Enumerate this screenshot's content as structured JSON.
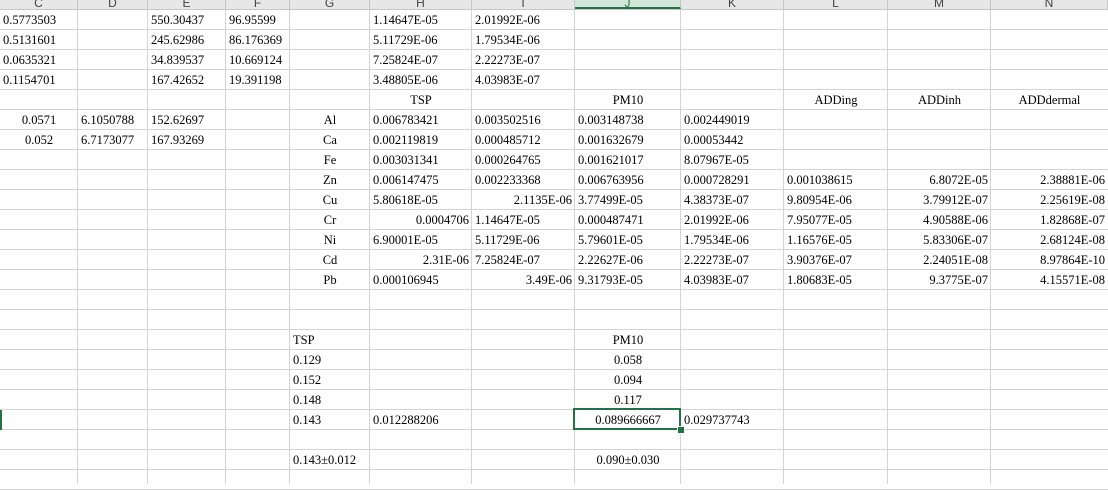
{
  "columns": [
    "C",
    "D",
    "E",
    "F",
    "G",
    "H",
    "I",
    "J",
    "K",
    "L",
    "M",
    "N"
  ],
  "selected_column": "J",
  "rows": [
    [
      {
        "c": 0,
        "v": "0.5773503",
        "a": "l"
      },
      {
        "c": 2,
        "v": "550.30437",
        "a": "l"
      },
      {
        "c": 3,
        "v": "96.95599",
        "a": "l"
      },
      {
        "c": 5,
        "v": "1.14647E-05",
        "a": "l"
      },
      {
        "c": 6,
        "v": "2.01992E-06",
        "a": "l"
      }
    ],
    [
      {
        "c": 0,
        "v": "0.5131601",
        "a": "l"
      },
      {
        "c": 2,
        "v": "245.62986",
        "a": "l"
      },
      {
        "c": 3,
        "v": "86.176369",
        "a": "l"
      },
      {
        "c": 5,
        "v": "5.11729E-06",
        "a": "l"
      },
      {
        "c": 6,
        "v": "1.79534E-06",
        "a": "l"
      }
    ],
    [
      {
        "c": 0,
        "v": "0.0635321",
        "a": "l"
      },
      {
        "c": 2,
        "v": "34.839537",
        "a": "l"
      },
      {
        "c": 3,
        "v": "10.669124",
        "a": "l"
      },
      {
        "c": 5,
        "v": "7.25824E-07",
        "a": "l"
      },
      {
        "c": 6,
        "v": "2.22273E-07",
        "a": "l"
      }
    ],
    [
      {
        "c": 0,
        "v": "0.1154701",
        "a": "l"
      },
      {
        "c": 2,
        "v": "167.42652",
        "a": "l"
      },
      {
        "c": 3,
        "v": "19.391198",
        "a": "l"
      },
      {
        "c": 5,
        "v": "3.48805E-06",
        "a": "l"
      },
      {
        "c": 6,
        "v": "4.03983E-07",
        "a": "l"
      }
    ],
    [
      {
        "c": 5,
        "v": "TSP",
        "a": "c"
      },
      {
        "c": 7,
        "v": "PM10",
        "a": "c"
      },
      {
        "c": 9,
        "v": "ADDing",
        "a": "c"
      },
      {
        "c": 10,
        "v": "ADDinh",
        "a": "c"
      },
      {
        "c": 11,
        "v": "ADDdermal",
        "a": "c"
      }
    ],
    [
      {
        "c": 0,
        "v": "0.0571",
        "a": "c"
      },
      {
        "c": 1,
        "v": "6.1050788",
        "a": "l"
      },
      {
        "c": 2,
        "v": "152.62697",
        "a": "l"
      },
      {
        "c": 4,
        "v": "Al",
        "a": "c"
      },
      {
        "c": 5,
        "v": "0.006783421",
        "a": "l"
      },
      {
        "c": 6,
        "v": "0.003502516",
        "a": "l"
      },
      {
        "c": 7,
        "v": "0.003148738",
        "a": "l"
      },
      {
        "c": 8,
        "v": "0.002449019",
        "a": "l"
      }
    ],
    [
      {
        "c": 0,
        "v": "0.052",
        "a": "c"
      },
      {
        "c": 1,
        "v": "6.7173077",
        "a": "l"
      },
      {
        "c": 2,
        "v": "167.93269",
        "a": "l"
      },
      {
        "c": 4,
        "v": "Ca",
        "a": "c"
      },
      {
        "c": 5,
        "v": "0.002119819",
        "a": "l"
      },
      {
        "c": 6,
        "v": "0.000485712",
        "a": "l"
      },
      {
        "c": 7,
        "v": "0.001632679",
        "a": "l"
      },
      {
        "c": 8,
        "v": "0.00053442",
        "a": "l"
      }
    ],
    [
      {
        "c": 4,
        "v": "Fe",
        "a": "c"
      },
      {
        "c": 5,
        "v": "0.003031341",
        "a": "l"
      },
      {
        "c": 6,
        "v": "0.000264765",
        "a": "l"
      },
      {
        "c": 7,
        "v": "0.001621017",
        "a": "l"
      },
      {
        "c": 8,
        "v": "8.07967E-05",
        "a": "l"
      }
    ],
    [
      {
        "c": 4,
        "v": "Zn",
        "a": "c"
      },
      {
        "c": 5,
        "v": "0.006147475",
        "a": "l"
      },
      {
        "c": 6,
        "v": "0.002233368",
        "a": "l"
      },
      {
        "c": 7,
        "v": "0.006763956",
        "a": "l"
      },
      {
        "c": 8,
        "v": "0.000728291",
        "a": "l"
      },
      {
        "c": 9,
        "v": "0.001038615",
        "a": "l"
      },
      {
        "c": 10,
        "v": "6.8072E-05",
        "a": "r"
      },
      {
        "c": 11,
        "v": "2.38881E-06",
        "a": "r"
      }
    ],
    [
      {
        "c": 4,
        "v": "Cu",
        "a": "c"
      },
      {
        "c": 5,
        "v": "5.80618E-05",
        "a": "l"
      },
      {
        "c": 6,
        "v": "2.1135E-06",
        "a": "r"
      },
      {
        "c": 7,
        "v": "3.77499E-05",
        "a": "l"
      },
      {
        "c": 8,
        "v": "4.38373E-07",
        "a": "l"
      },
      {
        "c": 9,
        "v": "9.80954E-06",
        "a": "l"
      },
      {
        "c": 10,
        "v": "3.79912E-07",
        "a": "r"
      },
      {
        "c": 11,
        "v": "2.25619E-08",
        "a": "r"
      }
    ],
    [
      {
        "c": 4,
        "v": "Cr",
        "a": "c"
      },
      {
        "c": 5,
        "v": "0.0004706",
        "a": "r"
      },
      {
        "c": 6,
        "v": "1.14647E-05",
        "a": "l"
      },
      {
        "c": 7,
        "v": "0.000487471",
        "a": "l"
      },
      {
        "c": 8,
        "v": "2.01992E-06",
        "a": "l"
      },
      {
        "c": 9,
        "v": "7.95077E-05",
        "a": "l"
      },
      {
        "c": 10,
        "v": "4.90588E-06",
        "a": "r"
      },
      {
        "c": 11,
        "v": "1.82868E-07",
        "a": "r"
      }
    ],
    [
      {
        "c": 4,
        "v": "Ni",
        "a": "c"
      },
      {
        "c": 5,
        "v": "6.90001E-05",
        "a": "l"
      },
      {
        "c": 6,
        "v": "5.11729E-06",
        "a": "l"
      },
      {
        "c": 7,
        "v": "5.79601E-05",
        "a": "l"
      },
      {
        "c": 8,
        "v": "1.79534E-06",
        "a": "l"
      },
      {
        "c": 9,
        "v": "1.16576E-05",
        "a": "l"
      },
      {
        "c": 10,
        "v": "5.83306E-07",
        "a": "r"
      },
      {
        "c": 11,
        "v": "2.68124E-08",
        "a": "r"
      }
    ],
    [
      {
        "c": 4,
        "v": "Cd",
        "a": "c"
      },
      {
        "c": 5,
        "v": "2.31E-06",
        "a": "r"
      },
      {
        "c": 6,
        "v": "7.25824E-07",
        "a": "l"
      },
      {
        "c": 7,
        "v": "2.22627E-06",
        "a": "l"
      },
      {
        "c": 8,
        "v": "2.22273E-07",
        "a": "l"
      },
      {
        "c": 9,
        "v": "3.90376E-07",
        "a": "l"
      },
      {
        "c": 10,
        "v": "2.24051E-08",
        "a": "r"
      },
      {
        "c": 11,
        "v": "8.97864E-10",
        "a": "r"
      }
    ],
    [
      {
        "c": 4,
        "v": "Pb",
        "a": "c"
      },
      {
        "c": 5,
        "v": "0.000106945",
        "a": "l"
      },
      {
        "c": 6,
        "v": "3.49E-06",
        "a": "r"
      },
      {
        "c": 7,
        "v": "9.31793E-05",
        "a": "l"
      },
      {
        "c": 8,
        "v": "4.03983E-07",
        "a": "l"
      },
      {
        "c": 9,
        "v": "1.80683E-05",
        "a": "l"
      },
      {
        "c": 10,
        "v": "9.3775E-07",
        "a": "r"
      },
      {
        "c": 11,
        "v": "4.15571E-08",
        "a": "r"
      }
    ],
    [],
    [],
    [
      {
        "c": 4,
        "v": "TSP",
        "a": "l"
      },
      {
        "c": 7,
        "v": "PM10",
        "a": "c"
      }
    ],
    [
      {
        "c": 4,
        "v": "0.129",
        "a": "l"
      },
      {
        "c": 7,
        "v": "0.058",
        "a": "c"
      }
    ],
    [
      {
        "c": 4,
        "v": "0.152",
        "a": "l"
      },
      {
        "c": 7,
        "v": "0.094",
        "a": "c"
      }
    ],
    [
      {
        "c": 4,
        "v": "0.148",
        "a": "l"
      },
      {
        "c": 7,
        "v": "0.117",
        "a": "c"
      }
    ],
    [
      {
        "c": 4,
        "v": "0.143",
        "a": "l"
      },
      {
        "c": 5,
        "v": "0.012288206",
        "a": "l"
      },
      {
        "c": 7,
        "v": "0.089666667",
        "a": "c"
      },
      {
        "c": 8,
        "v": "0.029737743",
        "a": "l"
      }
    ],
    [],
    [
      {
        "c": 4,
        "v": "0.143±0.012",
        "a": "l"
      },
      {
        "c": 7,
        "v": "0.090±0.030",
        "a": "c"
      }
    ]
  ],
  "active_cell": {
    "row": 20,
    "col": 7
  }
}
